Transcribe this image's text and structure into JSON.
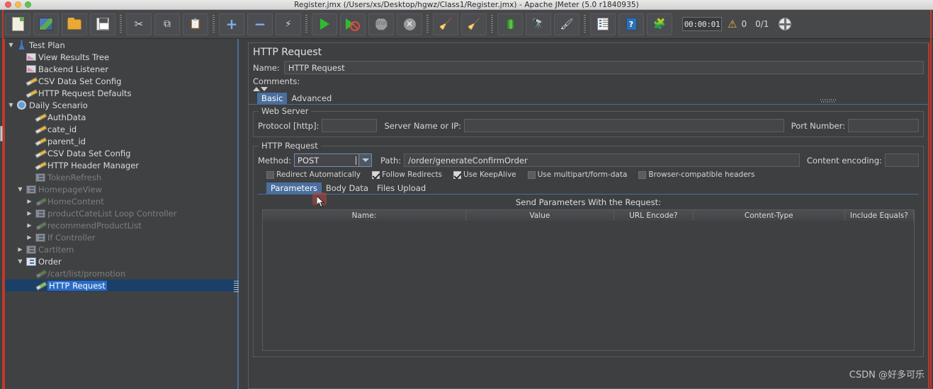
{
  "window": {
    "title": "Register.jmx (/Users/xs/Desktop/hgwz/Class1/Register.jmx) - Apache JMeter (5.0 r1840935)",
    "traffic_lights": [
      "close",
      "minimize",
      "maximize"
    ]
  },
  "toolbar": {
    "buttons": [
      {
        "name": "new",
        "icon": "new-document-icon"
      },
      {
        "name": "templates",
        "icon": "templates-icon"
      },
      {
        "name": "open",
        "icon": "open-folder-icon"
      },
      {
        "name": "save",
        "icon": "save-icon"
      },
      {
        "name": "cut",
        "icon": "scissors-icon"
      },
      {
        "name": "copy",
        "icon": "copy-icon"
      },
      {
        "name": "paste",
        "icon": "clipboard-paste-icon"
      },
      {
        "name": "expand",
        "icon": "plus-icon"
      },
      {
        "name": "collapse",
        "icon": "minus-icon"
      },
      {
        "name": "toggle",
        "icon": "toggle-icon"
      },
      {
        "name": "start",
        "icon": "play-icon"
      },
      {
        "name": "start-no-pauses",
        "icon": "play-no-pauses-icon"
      },
      {
        "name": "stop",
        "icon": "stop-icon"
      },
      {
        "name": "shutdown",
        "icon": "shutdown-icon"
      },
      {
        "name": "clear",
        "icon": "clear-icon"
      },
      {
        "name": "clear-all",
        "icon": "clear-all-icon"
      },
      {
        "name": "search",
        "icon": "bug-icon"
      },
      {
        "name": "search-reset",
        "icon": "binoculars-icon"
      },
      {
        "name": "function-helper",
        "icon": "broom-icon"
      },
      {
        "name": "log-viewer",
        "icon": "log-list-icon"
      },
      {
        "name": "help",
        "icon": "help-icon"
      },
      {
        "name": "undo-redo",
        "icon": "cleanup-icon"
      }
    ],
    "timer": "00:00:01",
    "warning_count": "0",
    "thread_count": "0/1",
    "globe_icon": "globe-icon"
  },
  "tree": {
    "nodes": [
      {
        "label": "Test Plan",
        "indent": 0,
        "toggle": "down",
        "icon": "test-plan-icon",
        "state": "enabled"
      },
      {
        "label": "View Results Tree",
        "indent": 1,
        "toggle": "none",
        "icon": "listener-icon",
        "state": "enabled"
      },
      {
        "label": "Backend Listener",
        "indent": 1,
        "toggle": "none",
        "icon": "listener-icon",
        "state": "enabled"
      },
      {
        "label": "CSV Data Set Config",
        "indent": 1,
        "toggle": "none",
        "icon": "config-icon",
        "state": "enabled"
      },
      {
        "label": "HTTP Request Defaults",
        "indent": 1,
        "toggle": "none",
        "icon": "config-icon",
        "state": "enabled"
      },
      {
        "label": "Daily Scenario",
        "indent": 0,
        "toggle": "down",
        "icon": "thread-group-icon",
        "state": "enabled"
      },
      {
        "label": "AuthData",
        "indent": 2,
        "toggle": "none",
        "icon": "config-icon",
        "state": "enabled"
      },
      {
        "label": "cate_id",
        "indent": 2,
        "toggle": "none",
        "icon": "config-icon",
        "state": "enabled"
      },
      {
        "label": "parent_id",
        "indent": 2,
        "toggle": "none",
        "icon": "config-icon",
        "state": "enabled"
      },
      {
        "label": "CSV Data Set Config",
        "indent": 2,
        "toggle": "none",
        "icon": "config-icon",
        "state": "enabled"
      },
      {
        "label": "HTTP Header Manager",
        "indent": 2,
        "toggle": "none",
        "icon": "config-icon",
        "state": "enabled"
      },
      {
        "label": "TokenRefresh",
        "indent": 2,
        "toggle": "none",
        "icon": "controller-icon",
        "state": "disabled"
      },
      {
        "label": "HomepageView",
        "indent": 1,
        "toggle": "down",
        "icon": "controller-icon",
        "state": "disabled"
      },
      {
        "label": "HomeContent",
        "indent": 2,
        "toggle": "right",
        "icon": "sampler-icon",
        "state": "disabled"
      },
      {
        "label": "productCateList Loop Controller",
        "indent": 2,
        "toggle": "right",
        "icon": "controller-icon",
        "state": "disabled"
      },
      {
        "label": "recommendProductList",
        "indent": 2,
        "toggle": "right",
        "icon": "sampler-icon",
        "state": "disabled"
      },
      {
        "label": "If Controller",
        "indent": 2,
        "toggle": "right",
        "icon": "controller-icon",
        "state": "disabled"
      },
      {
        "label": "CartItem",
        "indent": 1,
        "toggle": "right",
        "icon": "controller-icon",
        "state": "disabled"
      },
      {
        "label": "Order",
        "indent": 1,
        "toggle": "down",
        "icon": "controller-icon",
        "state": "enabled"
      },
      {
        "label": "/cart/list/promotion",
        "indent": 2,
        "toggle": "none",
        "icon": "sampler-icon",
        "state": "disabled"
      },
      {
        "label": "HTTP Request",
        "indent": 2,
        "toggle": "none",
        "icon": "sampler-icon",
        "state": "selected"
      }
    ]
  },
  "panel": {
    "title": "HTTP Request",
    "name_label": "Name:",
    "name_value": "HTTP Request",
    "comments_label": "Comments:",
    "comments_value": "",
    "tabs": [
      {
        "label": "Basic",
        "active": true
      },
      {
        "label": "Advanced",
        "active": false
      }
    ],
    "web_server": {
      "title": "Web Server",
      "protocol_label": "Protocol [http]:",
      "protocol_value": "",
      "server_label": "Server Name or IP:",
      "server_value": "",
      "port_label": "Port Number:",
      "port_value": ""
    },
    "http_request": {
      "title": "HTTP Request",
      "method_label": "Method:",
      "method_value": "POST",
      "path_label": "Path:",
      "path_value": "/order/generateConfirmOrder",
      "content_encoding_label": "Content encoding:",
      "content_encoding_value": ""
    },
    "checkboxes": [
      {
        "label": "Redirect Automatically",
        "checked": false
      },
      {
        "label": "Follow Redirects",
        "checked": true
      },
      {
        "label": "Use KeepAlive",
        "checked": true
      },
      {
        "label": "Use multipart/form-data",
        "checked": false
      },
      {
        "label": "Browser-compatible headers",
        "checked": false
      }
    ],
    "sub_tabs": [
      {
        "label": "Parameters",
        "active": true
      },
      {
        "label": "Body Data",
        "active": false
      },
      {
        "label": "Files Upload",
        "active": false
      }
    ],
    "send_params_title": "Send Parameters With the Request:",
    "table": {
      "columns": [
        "Name:",
        "Value",
        "URL Encode?",
        "Content-Type",
        "Include Equals?"
      ],
      "rows": []
    }
  },
  "watermark": "CSDN @好多可乐",
  "colors": {
    "accent_blue": "#2a6bc4",
    "tab_active": "#4a6f9e",
    "edge_red": "#c0392b",
    "panel_bg": "#3e3f41",
    "tree_bg": "#404143"
  }
}
